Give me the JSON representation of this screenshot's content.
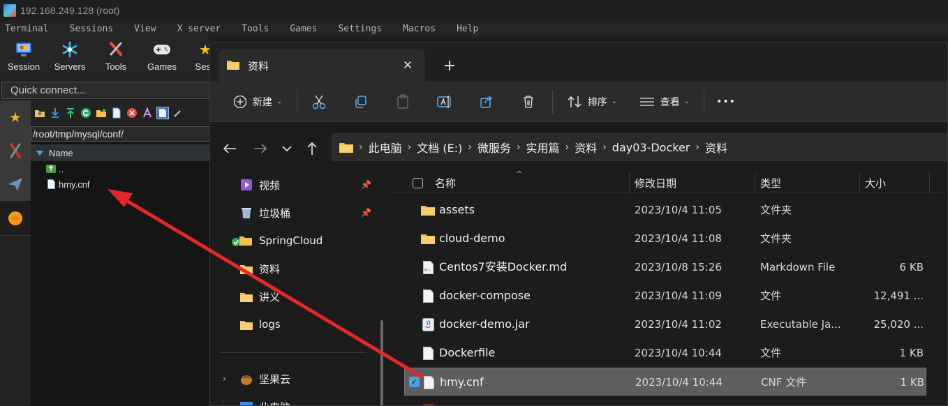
{
  "moba": {
    "title": "192.168.249.128 (root)",
    "menu": [
      "Terminal",
      "Sessions",
      "View",
      "X server",
      "Tools",
      "Games",
      "Settings",
      "Macros",
      "Help"
    ],
    "toolbar": [
      "Session",
      "Servers",
      "Tools",
      "Games",
      "Sess"
    ],
    "quick_connect_placeholder": "Quick connect...",
    "path": "/root/tmp/mysql/conf/",
    "column_name": "Name",
    "files": [
      "..",
      "hmy.cnf"
    ]
  },
  "explorer": {
    "tab_title": "资料",
    "new_tab_symbol": "+",
    "commands": {
      "new": "新建",
      "sort": "排序",
      "view": "查看",
      "more": "•••"
    },
    "breadcrumbs": [
      "此电脑",
      "文档 (E:)",
      "微服务",
      "实用篇",
      "资料",
      "day03-Docker",
      "资料"
    ],
    "nav": [
      {
        "label": "视频",
        "icon": "video-icon",
        "pinned": true
      },
      {
        "label": "垃圾桶",
        "icon": "recycle-bin-icon",
        "pinned": true
      },
      {
        "label": "SpringCloud",
        "icon": "folder-synced-icon",
        "pinned": false
      },
      {
        "label": "资料",
        "icon": "folder-icon",
        "pinned": false
      },
      {
        "label": "讲义",
        "icon": "folder-icon",
        "pinned": false
      },
      {
        "label": "logs",
        "icon": "folder-icon",
        "pinned": false
      },
      {
        "label": "坚果云",
        "icon": "nutstore-icon",
        "pinned": false
      },
      {
        "label": "此电脑",
        "icon": "this-pc-icon",
        "pinned": false
      }
    ],
    "columns": {
      "name": "名称",
      "date": "修改日期",
      "type": "类型",
      "size": "大小"
    },
    "files": [
      {
        "name": "assets",
        "date": "2023/10/4 11:05",
        "type": "文件夹",
        "size": "",
        "icon": "folder-icon",
        "selected": false
      },
      {
        "name": "cloud-demo",
        "date": "2023/10/4 11:08",
        "type": "文件夹",
        "size": "",
        "icon": "folder-icon",
        "selected": false
      },
      {
        "name": "Centos7安装Docker.md",
        "date": "2023/10/8 15:26",
        "type": "Markdown File",
        "size": "6 KB",
        "icon": "markdown-file-icon",
        "selected": false
      },
      {
        "name": "docker-compose",
        "date": "2023/10/4 11:09",
        "type": "文件",
        "size": "12,491 ...",
        "icon": "file-icon",
        "selected": false
      },
      {
        "name": "docker-demo.jar",
        "date": "2023/10/4 11:02",
        "type": "Executable Ja...",
        "size": "25,020 ...",
        "icon": "jar-file-icon",
        "selected": false
      },
      {
        "name": "Dockerfile",
        "date": "2023/10/4 10:44",
        "type": "文件",
        "size": "1 KB",
        "icon": "file-icon",
        "selected": false
      },
      {
        "name": "hmy.cnf",
        "date": "2023/10/4 10:44",
        "type": "CNF 文件",
        "size": "1 KB",
        "icon": "file-icon",
        "selected": true
      }
    ]
  },
  "colors": {
    "folder": "#f2c14e",
    "accent": "#4aa3e6",
    "annotation_arrow": "#e8262a"
  }
}
